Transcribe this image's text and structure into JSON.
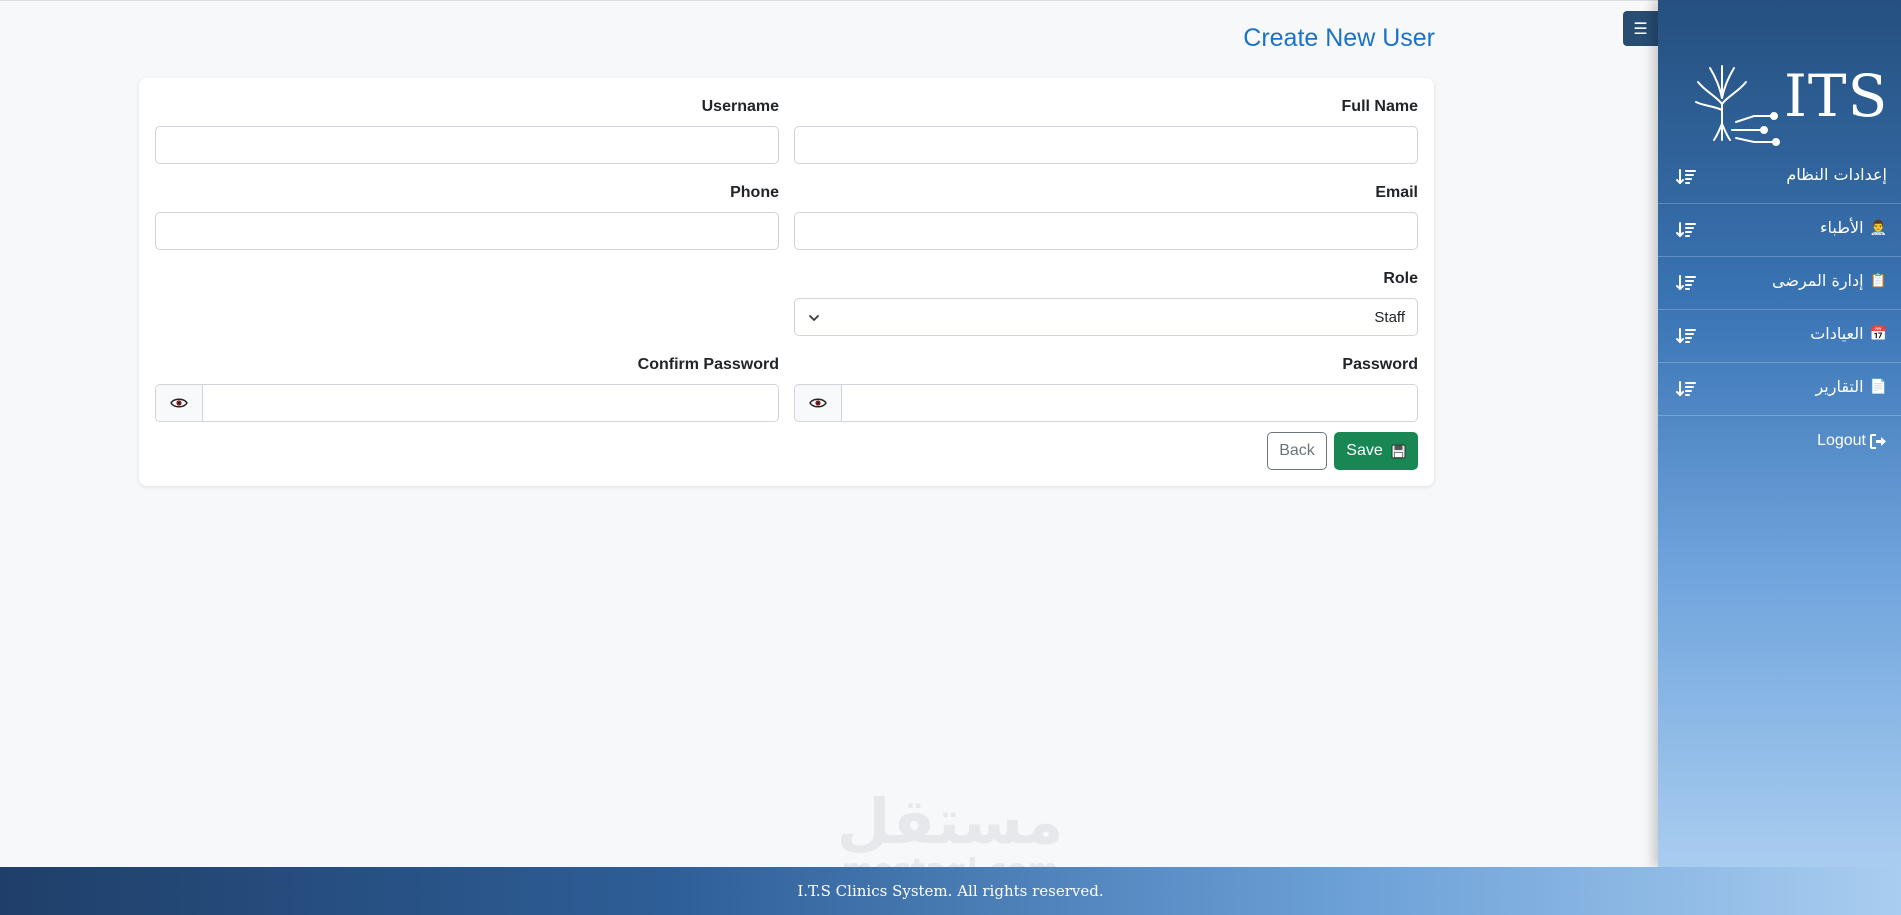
{
  "page": {
    "title": "Create New User"
  },
  "form": {
    "full_name": {
      "label": "Full Name",
      "value": ""
    },
    "username": {
      "label": "Username",
      "value": ""
    },
    "email": {
      "label": "Email",
      "value": ""
    },
    "phone": {
      "label": "Phone",
      "value": ""
    },
    "role": {
      "label": "Role",
      "value": "Staff"
    },
    "password": {
      "label": "Password",
      "value": ""
    },
    "confirm_password": {
      "label": "Confirm Password",
      "value": ""
    }
  },
  "buttons": {
    "save": "Save",
    "back": "Back"
  },
  "sidebar": {
    "toggle_icon": "☰",
    "logo_text": "ITS",
    "items": [
      {
        "label": "إعدادات النظام",
        "icon": ""
      },
      {
        "label": "الأطباء",
        "icon": "👨‍⚕️"
      },
      {
        "label": "إدارة المرضى",
        "icon": "📋"
      },
      {
        "label": "العيادات",
        "icon": "📅"
      },
      {
        "label": "التقارير",
        "icon": "📄"
      }
    ],
    "logout": "Logout"
  },
  "footer": {
    "text": "I.T.S Clinics System. All rights reserved."
  },
  "watermark": {
    "arabic": "مستقل",
    "latin": "mostaql.com"
  },
  "colors": {
    "accent": "#1a73c9",
    "save": "#198754",
    "sidebar_top": "#25507f",
    "sidebar_bottom": "#a9cdf0"
  }
}
